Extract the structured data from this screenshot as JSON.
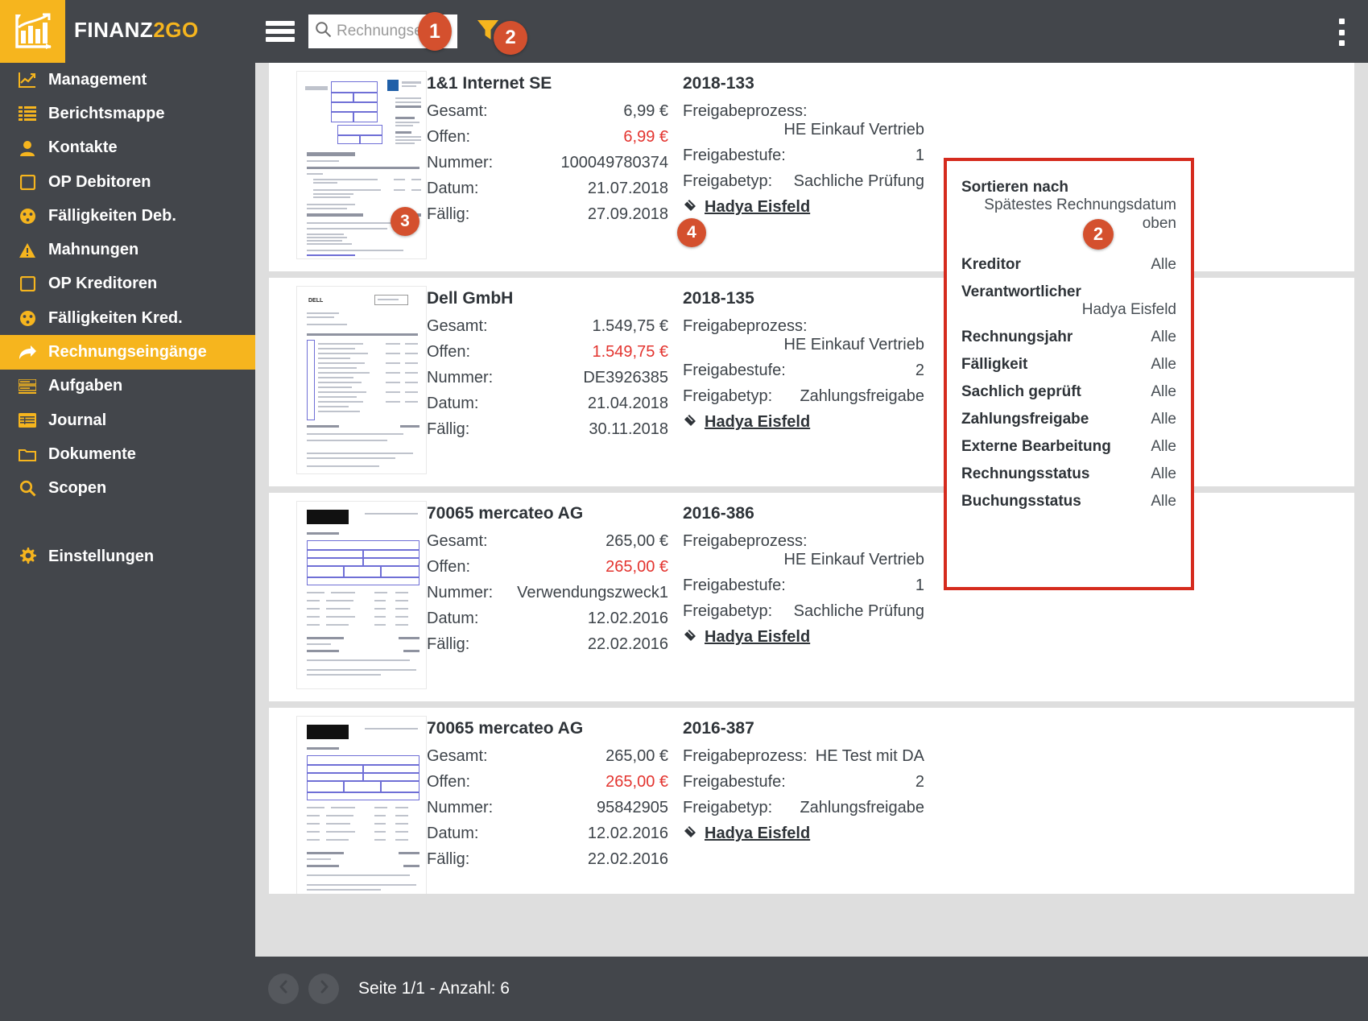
{
  "header": {
    "brand_main": "FINANZ",
    "brand_accent": "2GO",
    "logo_icon": "bar-chart-growth-icon",
    "menu_icon": "hamburger-menu-icon",
    "search": {
      "value": "",
      "placeholder": "Rechnungsei",
      "icon": "search-icon"
    },
    "filter_icon": "filter-funnel-icon",
    "overflow_icon": "vertical-dots-icon",
    "accent_color": "#f6b51e",
    "bar_color": "#43464b"
  },
  "sidebar": {
    "items": [
      {
        "label": "Management",
        "icon": "line-chart-icon",
        "active": false
      },
      {
        "label": "Berichtsmappe",
        "icon": "list-icon",
        "active": false
      },
      {
        "label": "Kontakte",
        "icon": "person-icon",
        "active": false
      },
      {
        "label": "OP Debitoren",
        "icon": "square-icon",
        "active": false
      },
      {
        "label": "Fälligkeiten Deb.",
        "icon": "gauge-icon",
        "active": false
      },
      {
        "label": "Mahnungen",
        "icon": "warning-icon",
        "active": false
      },
      {
        "label": "OP Kreditoren",
        "icon": "square-icon",
        "active": false
      },
      {
        "label": "Fälligkeiten Kred.",
        "icon": "gauge-icon",
        "active": false
      },
      {
        "label": "Rechnungseingänge",
        "icon": "arrow-forward-icon",
        "active": true
      },
      {
        "label": "Aufgaben",
        "icon": "tasks-icon",
        "active": false
      },
      {
        "label": "Journal",
        "icon": "table-icon",
        "active": false
      },
      {
        "label": "Dokumente",
        "icon": "folder-icon",
        "active": false
      },
      {
        "label": "Scopen",
        "icon": "magnifier-icon",
        "active": false
      }
    ],
    "settings": {
      "label": "Einstellungen",
      "icon": "gear-icon"
    }
  },
  "labels": {
    "gesamt": "Gesamt:",
    "offen": "Offen:",
    "nummer": "Nummer:",
    "datum": "Datum:",
    "faellig": "Fällig:",
    "freigabeprozess": "Freigabeprozess:",
    "freigabestufe": "Freigabestufe:",
    "freigabetyp": "Freigabetyp:"
  },
  "invoices": [
    {
      "creditor": "1&1 Internet SE",
      "gesamt": "6,99 €",
      "offen": "6,99 €",
      "nummer": "100049780374",
      "datum": "21.07.2018",
      "faellig": "27.09.2018",
      "doc_number": "2018-133",
      "freigabeprozess": "HE Einkauf Vertrieb",
      "freigabeprozess_inline": false,
      "freigabestufe": "1",
      "freigabetyp": "Sachliche Prüfung",
      "person": "Hadya Eisfeld",
      "person_icon": "tag-icon",
      "thumb_style": "oneandone"
    },
    {
      "creditor": "Dell GmbH",
      "gesamt": "1.549,75 €",
      "offen": "1.549,75 €",
      "nummer": "DE3926385",
      "datum": "21.04.2018",
      "faellig": "30.11.2018",
      "doc_number": "2018-135",
      "freigabeprozess": "HE Einkauf Vertrieb",
      "freigabeprozess_inline": false,
      "freigabestufe": "2",
      "freigabetyp": "Zahlungsfreigabe",
      "person": "Hadya Eisfeld",
      "person_icon": "tag-icon",
      "thumb_style": "dell"
    },
    {
      "creditor": "70065 mercateo AG",
      "gesamt": "265,00 €",
      "offen": "265,00 €",
      "nummer": "Verwendungszweck1",
      "datum": "12.02.2016",
      "faellig": "22.02.2016",
      "doc_number": "2016-386",
      "freigabeprozess": "HE Einkauf Vertrieb",
      "freigabeprozess_inline": false,
      "freigabestufe": "1",
      "freigabetyp": "Sachliche Prüfung",
      "person": "Hadya Eisfeld",
      "person_icon": "tag-icon",
      "thumb_style": "mercateo"
    },
    {
      "creditor": "70065 mercateo AG",
      "gesamt": "265,00 €",
      "offen": "265,00 €",
      "nummer": "95842905",
      "datum": "12.02.2016",
      "faellig": "22.02.2016",
      "doc_number": "2016-387",
      "freigabeprozess": "HE Test mit DA",
      "freigabeprozess_inline": true,
      "freigabestufe": "2",
      "freigabetyp": "Zahlungsfreigabe",
      "person": "Hadya Eisfeld",
      "person_icon": "tag-icon",
      "thumb_style": "mercateo"
    }
  ],
  "filter_panel": {
    "border_color": "#d52b1e",
    "sort": {
      "label": "Sortieren nach",
      "value_line1": "Spätestes Rechnungsdatum",
      "value_line2": "oben"
    },
    "rows": [
      {
        "label": "Kreditor",
        "value": "Alle"
      },
      {
        "label": "Verantwortlicher",
        "value": "Hadya Eisfeld",
        "below": true
      },
      {
        "label": "Rechnungsjahr",
        "value": "Alle"
      },
      {
        "label": "Fälligkeit",
        "value": "Alle"
      },
      {
        "label": "Sachlich geprüft",
        "value": "Alle"
      },
      {
        "label": "Zahlungsfreigabe",
        "value": "Alle"
      },
      {
        "label": "Externe Bearbeitung",
        "value": "Alle"
      },
      {
        "label": "Rechnungsstatus",
        "value": "Alle"
      },
      {
        "label": "Buchungsstatus",
        "value": "Alle"
      }
    ]
  },
  "markers": [
    {
      "id": "1",
      "target": "search-input"
    },
    {
      "id": "2",
      "target": "filter-button"
    },
    {
      "id": "3",
      "target": "invoice-thumbnail"
    },
    {
      "id": "4",
      "target": "responsible-person-link"
    },
    {
      "id": "2",
      "target": "filter-panel"
    }
  ],
  "footer": {
    "prev_icon": "chevron-left-icon",
    "next_icon": "chevron-right-icon",
    "page_info": "Seite 1/1 - Anzahl: 6"
  }
}
